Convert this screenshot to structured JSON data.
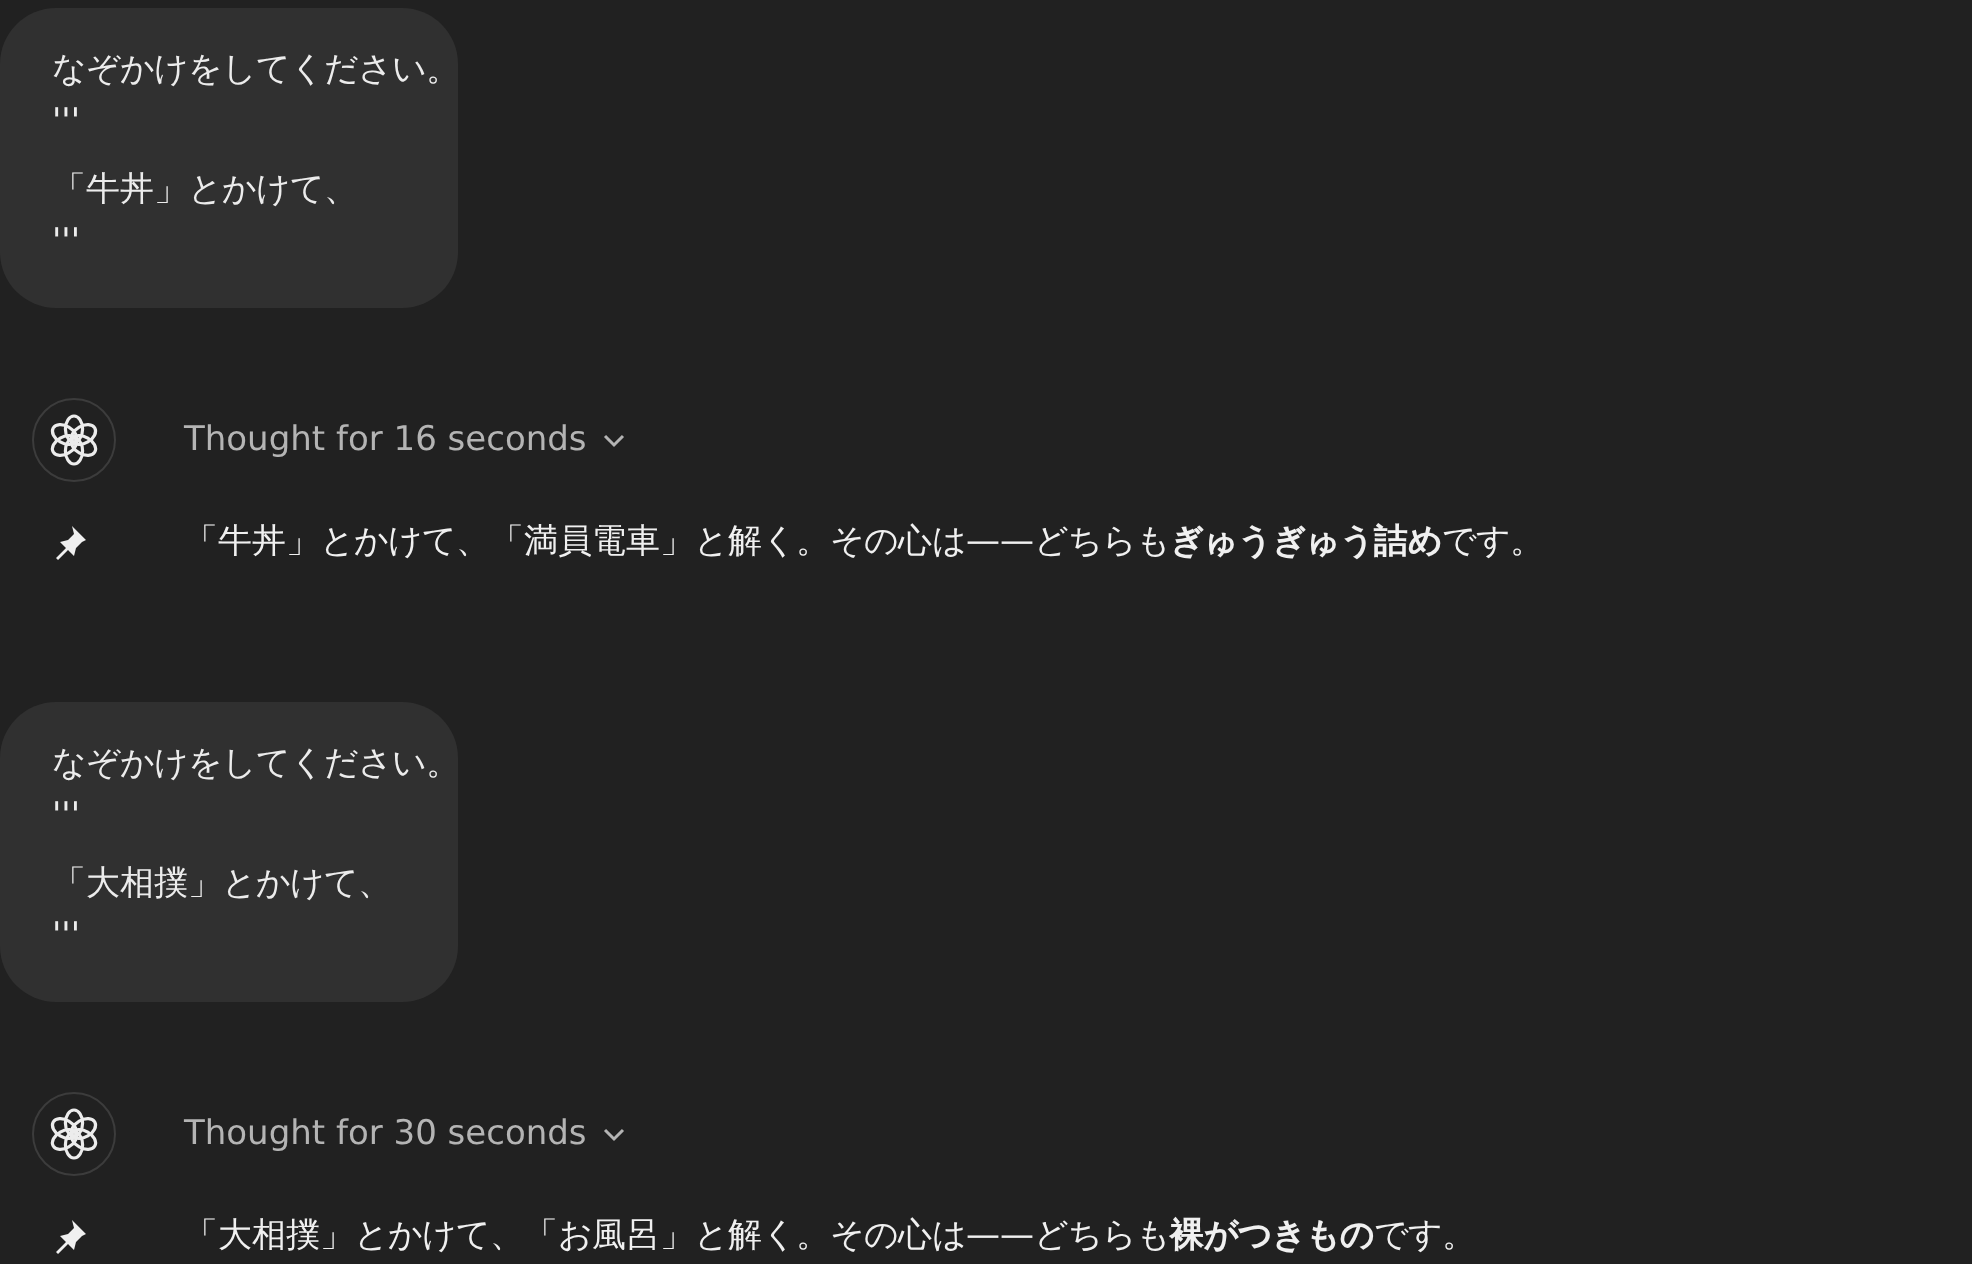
{
  "messages": [
    {
      "kind": "user",
      "paragraphs": [
        [
          "なぞかけをしてください。",
          "'''"
        ],
        [
          "「牛丼」とかけて、",
          "'''"
        ]
      ]
    },
    {
      "kind": "assistant",
      "thought": "Thought for 16 seconds",
      "expanded": false,
      "answer": "「牛丼」とかけて、「満員電車」と解く。その心は——どちらも**ぎゅうぎゅう詰め**です。"
    },
    {
      "kind": "user",
      "paragraphs": [
        [
          "なぞかけをしてください。",
          "'''"
        ],
        [
          "「大相撲」とかけて、",
          "'''"
        ]
      ]
    },
    {
      "kind": "assistant",
      "thought": "Thought for 30 seconds",
      "expanded": false,
      "answer": "「大相撲」とかけて、「お風呂」と解く。その心は——どちらも**裸がつきもの**です。"
    }
  ]
}
